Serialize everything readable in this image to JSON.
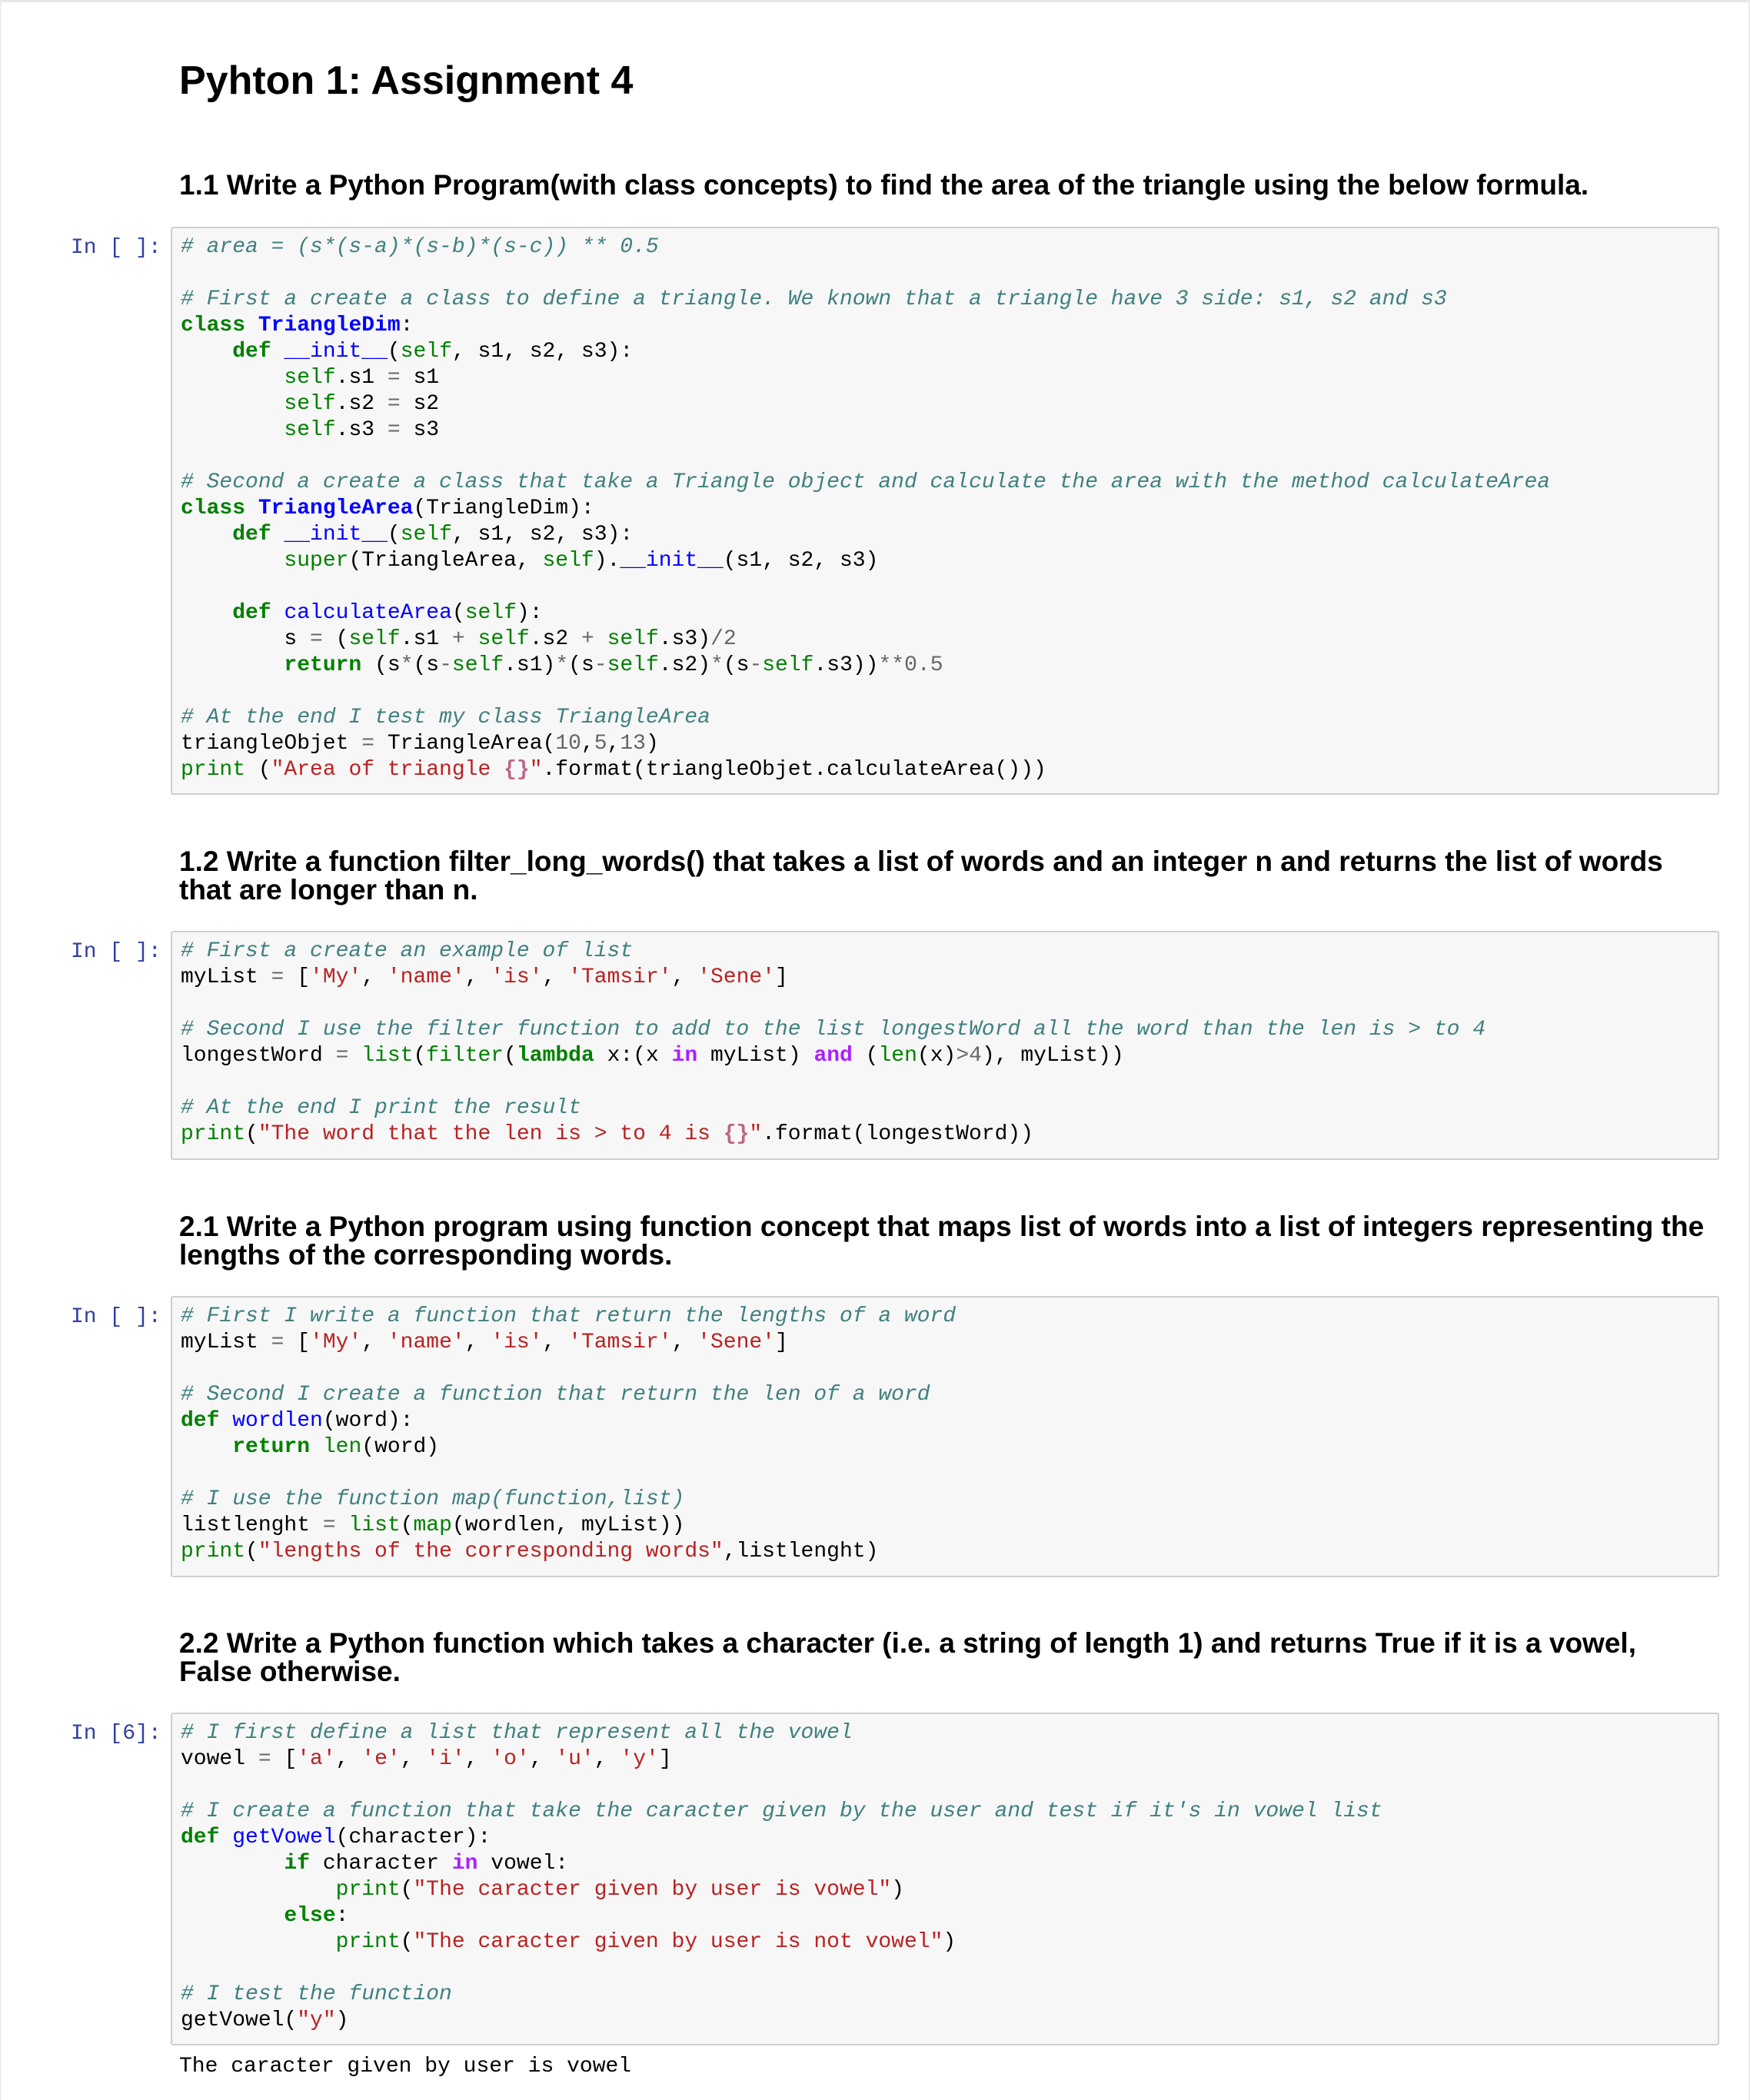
{
  "notebook": {
    "title": "Pyhton 1: Assignment 4",
    "sections": [
      {
        "heading": "1.1 Write a Python Program(with class concepts) to find the area of the triangle using the below formula.",
        "prompt": "In [ ]:",
        "code": [
          [
            [
              "c",
              "# area = (s*(s-a)*(s-b)*(s-c)) ** 0.5"
            ]
          ],
          [],
          [
            [
              "c",
              "# First a create a class to define a triangle. We known that a triangle have 3 side: s1, s2 and s3"
            ]
          ],
          [
            [
              "k",
              "class"
            ],
            [
              "",
              " "
            ],
            [
              "nc",
              "TriangleDim"
            ],
            [
              "",
              ":"
            ]
          ],
          [
            [
              "",
              "    "
            ],
            [
              "k",
              "def"
            ],
            [
              "",
              " "
            ],
            [
              "nf",
              "__init__"
            ],
            [
              "",
              "("
            ],
            [
              "bp",
              "self"
            ],
            [
              "",
              ", s1, s2, s3):"
            ]
          ],
          [
            [
              "",
              "        "
            ],
            [
              "bp",
              "self"
            ],
            [
              "",
              ".s1 "
            ],
            [
              "o",
              "="
            ],
            [
              "",
              " s1"
            ]
          ],
          [
            [
              "",
              "        "
            ],
            [
              "bp",
              "self"
            ],
            [
              "",
              ".s2 "
            ],
            [
              "o",
              "="
            ],
            [
              "",
              " s2"
            ]
          ],
          [
            [
              "",
              "        "
            ],
            [
              "bp",
              "self"
            ],
            [
              "",
              ".s3 "
            ],
            [
              "o",
              "="
            ],
            [
              "",
              " s3"
            ]
          ],
          [],
          [
            [
              "c",
              "# Second a create a class that take a Triangle object and calculate the area with the method calculateArea"
            ]
          ],
          [
            [
              "k",
              "class"
            ],
            [
              "",
              " "
            ],
            [
              "nc",
              "TriangleArea"
            ],
            [
              "",
              "(TriangleDim):"
            ]
          ],
          [
            [
              "",
              "    "
            ],
            [
              "k",
              "def"
            ],
            [
              "",
              " "
            ],
            [
              "nf",
              "__init__"
            ],
            [
              "",
              "("
            ],
            [
              "bp",
              "self"
            ],
            [
              "",
              ", s1, s2, s3):"
            ]
          ],
          [
            [
              "",
              "        "
            ],
            [
              "b",
              "super"
            ],
            [
              "",
              "(TriangleArea, "
            ],
            [
              "bp",
              "self"
            ],
            [
              "",
              ")."
            ],
            [
              "nf",
              "__init__"
            ],
            [
              "",
              "(s1, s2, s3)"
            ]
          ],
          [],
          [
            [
              "",
              "    "
            ],
            [
              "k",
              "def"
            ],
            [
              "",
              " "
            ],
            [
              "nf",
              "calculateArea"
            ],
            [
              "",
              "("
            ],
            [
              "bp",
              "self"
            ],
            [
              "",
              "):"
            ]
          ],
          [
            [
              "",
              "        s "
            ],
            [
              "o",
              "="
            ],
            [
              "",
              " ("
            ],
            [
              "bp",
              "self"
            ],
            [
              "",
              ".s1 "
            ],
            [
              "o",
              "+"
            ],
            [
              "",
              " "
            ],
            [
              "bp",
              "self"
            ],
            [
              "",
              ".s2 "
            ],
            [
              "o",
              "+"
            ],
            [
              "",
              " "
            ],
            [
              "bp",
              "self"
            ],
            [
              "",
              ".s3)"
            ],
            [
              "o",
              "/"
            ],
            [
              "m",
              "2"
            ]
          ],
          [
            [
              "",
              "        "
            ],
            [
              "k",
              "return"
            ],
            [
              "",
              " (s"
            ],
            [
              "o",
              "*"
            ],
            [
              "",
              "(s"
            ],
            [
              "o",
              "-"
            ],
            [
              "bp",
              "self"
            ],
            [
              "",
              ".s1)"
            ],
            [
              "o",
              "*"
            ],
            [
              "",
              "(s"
            ],
            [
              "o",
              "-"
            ],
            [
              "bp",
              "self"
            ],
            [
              "",
              ".s2)"
            ],
            [
              "o",
              "*"
            ],
            [
              "",
              "(s"
            ],
            [
              "o",
              "-"
            ],
            [
              "bp",
              "self"
            ],
            [
              "",
              ".s3))"
            ],
            [
              "o",
              "**"
            ],
            [
              "m",
              "0.5"
            ]
          ],
          [],
          [
            [
              "c",
              "# At the end I test my class TriangleArea"
            ]
          ],
          [
            [
              "",
              "triangleObjet "
            ],
            [
              "o",
              "="
            ],
            [
              "",
              " TriangleArea("
            ],
            [
              "m",
              "10"
            ],
            [
              "",
              ","
            ],
            [
              "m",
              "5"
            ],
            [
              "",
              ","
            ],
            [
              "m",
              "13"
            ],
            [
              "",
              ")"
            ]
          ],
          [
            [
              "b",
              "print"
            ],
            [
              "",
              " ("
            ],
            [
              "s",
              "\"Area of triangle "
            ],
            [
              "si",
              "{}"
            ],
            [
              "s",
              "\""
            ],
            [
              "",
              ".format(triangleObjet.calculateArea()))"
            ]
          ]
        ]
      },
      {
        "heading": "1.2 Write a function filter_long_words() that takes a list of words and an integer n and returns the list of words that are longer than n.",
        "prompt": "In [ ]:",
        "code": [
          [
            [
              "c",
              "# First a create an example of list"
            ]
          ],
          [
            [
              "",
              "myList "
            ],
            [
              "o",
              "="
            ],
            [
              "",
              " ["
            ],
            [
              "s",
              "'My'"
            ],
            [
              "",
              ", "
            ],
            [
              "s",
              "'name'"
            ],
            [
              "",
              ", "
            ],
            [
              "s",
              "'is'"
            ],
            [
              "",
              ", "
            ],
            [
              "s",
              "'Tamsir'"
            ],
            [
              "",
              ", "
            ],
            [
              "s",
              "'Sene'"
            ],
            [
              "",
              "]"
            ]
          ],
          [],
          [
            [
              "c",
              "# Second I use the filter function to add to the list longestWord all the word than the len is > to 4"
            ]
          ],
          [
            [
              "",
              "longestWord "
            ],
            [
              "o",
              "="
            ],
            [
              "",
              " "
            ],
            [
              "b",
              "list"
            ],
            [
              "",
              "("
            ],
            [
              "b",
              "filter"
            ],
            [
              "",
              "("
            ],
            [
              "k",
              "lambda"
            ],
            [
              "",
              " x:(x "
            ],
            [
              "ow",
              "in"
            ],
            [
              "",
              " myList) "
            ],
            [
              "ow",
              "and"
            ],
            [
              "",
              " ("
            ],
            [
              "b",
              "len"
            ],
            [
              "",
              "(x)"
            ],
            [
              "o",
              ">"
            ],
            [
              "m",
              "4"
            ],
            [
              "",
              "), myList))"
            ]
          ],
          [],
          [
            [
              "c",
              "# At the end I print the result"
            ]
          ],
          [
            [
              "b",
              "print"
            ],
            [
              "",
              "("
            ],
            [
              "s",
              "\"The word that the len is > to 4 is "
            ],
            [
              "si",
              "{}"
            ],
            [
              "s",
              "\""
            ],
            [
              "",
              ".format(longestWord))"
            ]
          ]
        ]
      },
      {
        "heading": "2.1 Write a Python program using function concept that maps list of words into a list of integers representing the lengths of the corresponding words.",
        "prompt": "In [ ]:",
        "code": [
          [
            [
              "c",
              "# First I write a function that return the lengths of a word"
            ]
          ],
          [
            [
              "",
              "myList "
            ],
            [
              "o",
              "="
            ],
            [
              "",
              " ["
            ],
            [
              "s",
              "'My'"
            ],
            [
              "",
              ", "
            ],
            [
              "s",
              "'name'"
            ],
            [
              "",
              ", "
            ],
            [
              "s",
              "'is'"
            ],
            [
              "",
              ", "
            ],
            [
              "s",
              "'Tamsir'"
            ],
            [
              "",
              ", "
            ],
            [
              "s",
              "'Sene'"
            ],
            [
              "",
              "]"
            ]
          ],
          [],
          [
            [
              "c",
              "# Second I create a function that return the len of a word"
            ]
          ],
          [
            [
              "k",
              "def"
            ],
            [
              "",
              " "
            ],
            [
              "nf",
              "wordlen"
            ],
            [
              "",
              "(word):"
            ]
          ],
          [
            [
              "",
              "    "
            ],
            [
              "k",
              "return"
            ],
            [
              "",
              " "
            ],
            [
              "b",
              "len"
            ],
            [
              "",
              "(word)"
            ]
          ],
          [],
          [
            [
              "c",
              "# I use the function map(function,list)"
            ]
          ],
          [
            [
              "",
              "listlenght "
            ],
            [
              "o",
              "="
            ],
            [
              "",
              " "
            ],
            [
              "b",
              "list"
            ],
            [
              "",
              "("
            ],
            [
              "b",
              "map"
            ],
            [
              "",
              "(wordlen, myList))"
            ]
          ],
          [
            [
              "b",
              "print"
            ],
            [
              "",
              "("
            ],
            [
              "s",
              "\"lengths of the corresponding words\""
            ],
            [
              "",
              ",listlenght)"
            ]
          ]
        ]
      },
      {
        "heading": "2.2 Write a Python function which takes a character (i.e. a string of length 1) and returns True if it is a vowel, False otherwise.",
        "prompt": "In [6]:",
        "code": [
          [
            [
              "c",
              "# I first define a list that represent all the vowel"
            ]
          ],
          [
            [
              "",
              "vowel "
            ],
            [
              "o",
              "="
            ],
            [
              "",
              " ["
            ],
            [
              "s",
              "'a'"
            ],
            [
              "",
              ", "
            ],
            [
              "s",
              "'e'"
            ],
            [
              "",
              ", "
            ],
            [
              "s",
              "'i'"
            ],
            [
              "",
              ", "
            ],
            [
              "s",
              "'o'"
            ],
            [
              "",
              ", "
            ],
            [
              "s",
              "'u'"
            ],
            [
              "",
              ", "
            ],
            [
              "s",
              "'y'"
            ],
            [
              "",
              "]"
            ]
          ],
          [],
          [
            [
              "c",
              "# I create a function that take the caracter given by the user and test if it's in vowel list"
            ]
          ],
          [
            [
              "k",
              "def"
            ],
            [
              "",
              " "
            ],
            [
              "nf",
              "getVowel"
            ],
            [
              "",
              "(character):"
            ]
          ],
          [
            [
              "",
              "        "
            ],
            [
              "k",
              "if"
            ],
            [
              "",
              " character "
            ],
            [
              "ow",
              "in"
            ],
            [
              "",
              " vowel:"
            ]
          ],
          [
            [
              "",
              "            "
            ],
            [
              "b",
              "print"
            ],
            [
              "",
              "("
            ],
            [
              "s",
              "\"The caracter given by user is vowel\""
            ],
            [
              "",
              ")"
            ]
          ],
          [
            [
              "",
              "        "
            ],
            [
              "k",
              "else"
            ],
            [
              "",
              ":"
            ]
          ],
          [
            [
              "",
              "            "
            ],
            [
              "b",
              "print"
            ],
            [
              "",
              "("
            ],
            [
              "s",
              "\"The caracter given by user is not vowel\""
            ],
            [
              "",
              ")"
            ]
          ],
          [],
          [
            [
              "c",
              "# I test the function"
            ]
          ],
          [
            [
              "",
              "getVowel("
            ],
            [
              "s",
              "\"y\""
            ],
            [
              "",
              ")"
            ]
          ]
        ],
        "output": "The caracter given by user is vowel"
      }
    ]
  }
}
